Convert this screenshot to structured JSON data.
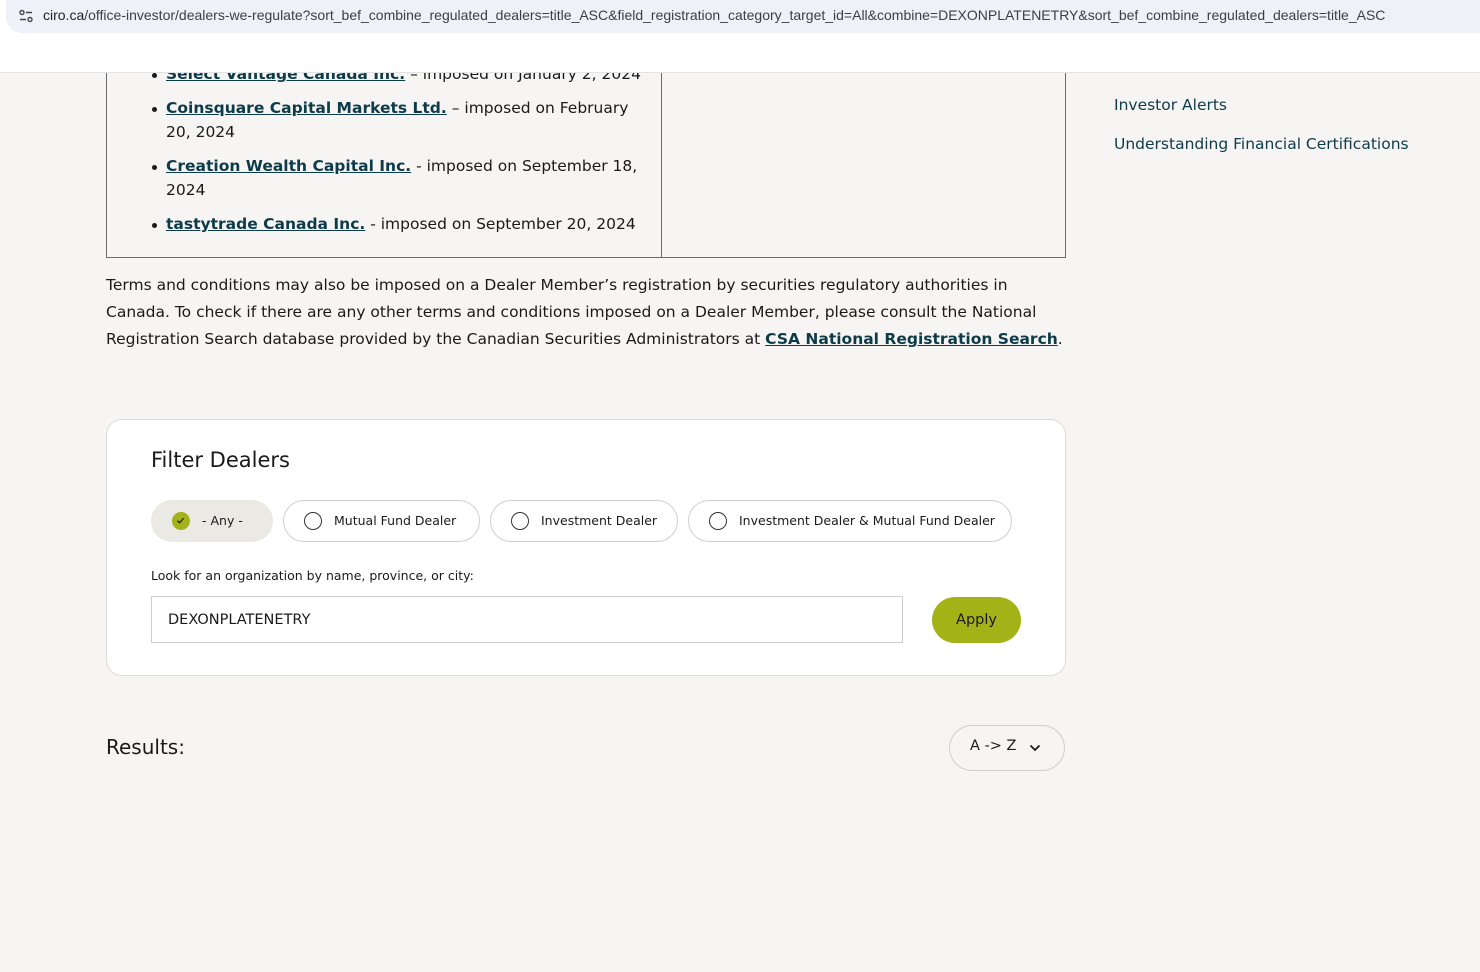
{
  "browser": {
    "url_host": "ciro.ca",
    "url_path": "/office-investor/dealers-we-regulate?sort_bef_combine_regulated_dealers=title_ASC&field_registration_category_target_id=All&combine=DEXONPLATENETRY&sort_bef_combine_regulated_dealers=title_ASC"
  },
  "terms_list": [
    {
      "name": "Select Vantage Canada Inc.",
      "detail": " – imposed on January 2, 2024"
    },
    {
      "name": "Coinsquare Capital Markets Ltd.",
      "detail": " – imposed on February 20, 2024"
    },
    {
      "name": "Creation Wealth Capital Inc.",
      "detail": " - imposed on September 18, 2024"
    },
    {
      "name": "tastytrade Canada Inc.",
      "detail": " - imposed on September 20, 2024"
    }
  ],
  "terms_paragraph": {
    "text": "Terms and conditions may also be imposed on a Dealer Member’s registration by securities regulatory authorities in Canada. To check if there are any other terms and conditions imposed on a Dealer Member, please consult the National Registration Search database provided by the Canadian Securities Administrators at ",
    "link": "CSA National Registration Search",
    "end": "."
  },
  "sidebar": {
    "links": [
      "Investor Alerts",
      "Understanding Financial Certifications"
    ]
  },
  "filter": {
    "title": "Filter Dealers",
    "options": [
      {
        "label": "- Any -",
        "selected": true
      },
      {
        "label": "Mutual Fund Dealer",
        "selected": false
      },
      {
        "label": "Investment Dealer",
        "selected": false
      },
      {
        "label": "Investment Dealer & Mutual Fund Dealer",
        "selected": false
      }
    ],
    "search_label": "Look for an organization by name, province, or city:",
    "search_value": "DEXONPLATENETRY",
    "apply_label": "Apply"
  },
  "results": {
    "title": "Results:",
    "sort_label": "A -> Z"
  },
  "colors": {
    "accent": "#a3b317",
    "link": "#0d3b4a",
    "background": "#f6f5f3"
  }
}
